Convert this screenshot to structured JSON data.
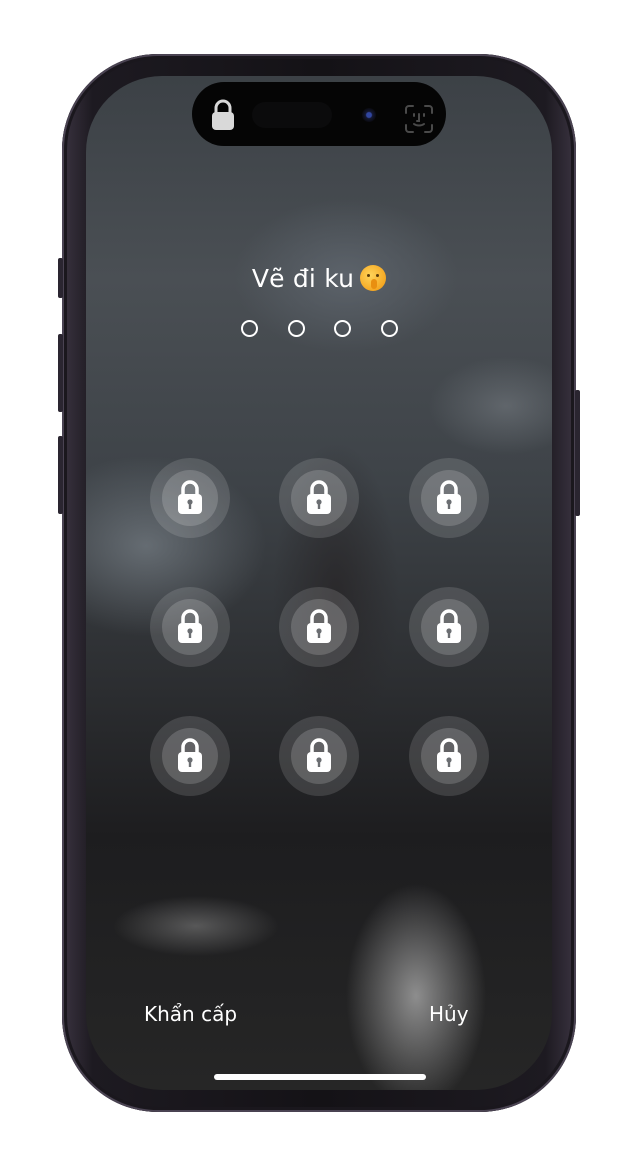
{
  "prompt": {
    "title": "Vẽ đi ku",
    "emoji_icon": "shushing-face-emoji"
  },
  "passcode": {
    "length": 4,
    "entered": 0
  },
  "keypad": {
    "icon": "padlock-icon",
    "keys": 9
  },
  "actions": {
    "emergency_label": "Khẩn cấp",
    "cancel_label": "Hủy"
  },
  "status": {
    "island_icon": "lock-icon",
    "sensor_icon": "face-id-icon"
  },
  "colors": {
    "text": "#ffffff",
    "key_fill": "rgba(255,255,255,0.13)"
  }
}
